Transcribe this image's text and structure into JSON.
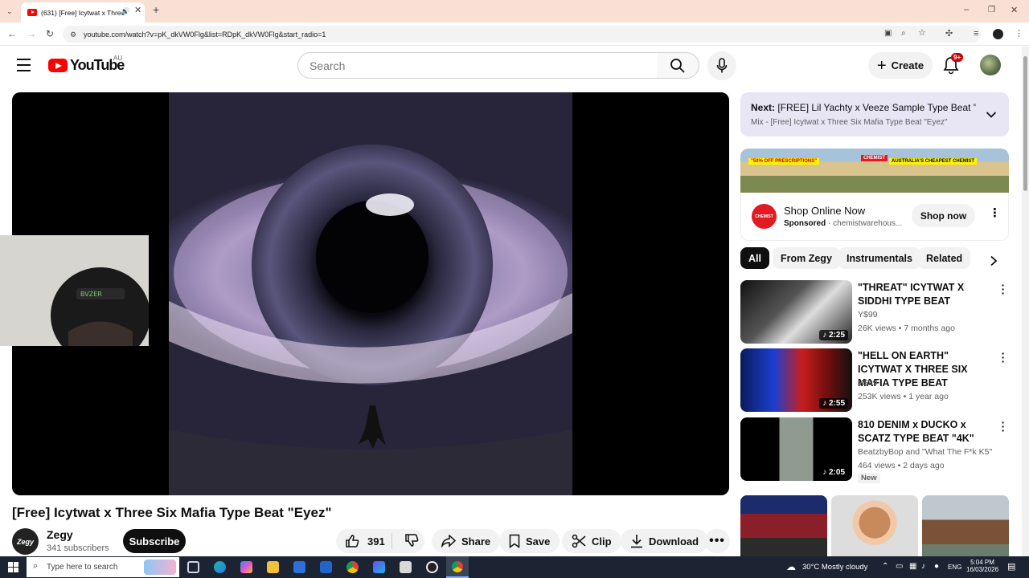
{
  "browser": {
    "tab_title": "(631) [Free] Icytwat x Three",
    "url": "youtube.com/watch?v=pK_dkVW0Flg&list=RDpK_dkVW0Flg&start_radio=1"
  },
  "header": {
    "logo": "YouTube",
    "region": "AU",
    "search_placeholder": "Search",
    "create_label": "Create",
    "notif_badge": "9+"
  },
  "video": {
    "title": "[Free] Icytwat x Three Six Mafia Type Beat \"Eyez\"",
    "channel": "Zegy",
    "channel_avatar": "Zegy",
    "subscribers": "341 subscribers",
    "subscribe_label": "Subscribe",
    "likes": "391",
    "share_label": "Share",
    "save_label": "Save",
    "clip_label": "Clip",
    "download_label": "Download"
  },
  "next": {
    "label": "Next:",
    "title": "[FREE] Lil Yachty x Veeze Sample Type Beat \"...",
    "sub": "Mix - [Free] Icytwat x Three Six Mafia Type Beat \"Eyez\""
  },
  "ad": {
    "banner1": "\"50% OFF PRESCRIPTIONS\"",
    "banner2": "AUSTRALIA'S CHEAPEST CHEMIST",
    "banner_brand": "CHEMIST",
    "brand_short": "CHEMIST",
    "headline": "Shop Online Now",
    "sponsored": "Sponsored",
    "domain": "chemistwarehous...",
    "cta": "Shop now"
  },
  "chips": [
    "All",
    "From Zegy",
    "Instrumentals",
    "Related"
  ],
  "recommendations": [
    {
      "title": "\"THREAT\" ICYTWAT X SIDDHI TYPE BEAT",
      "channel": "Y$99",
      "meta": "26K views • 7 months ago",
      "duration": "2:25",
      "badge": ""
    },
    {
      "title": "\"HELL ON EARTH\" ICYTWAT X THREE SIX MAFIA TYPE BEAT",
      "channel": "Y$99",
      "meta": "253K views • 1 year ago",
      "duration": "2:55",
      "badge": ""
    },
    {
      "title": "810 DENIM x DUCKO x SCATZ TYPE BEAT \"4K\"",
      "channel": "BeatzbyBop and \"What The F*k K5\"",
      "meta": "464 views • 2 days ago",
      "duration": "2:05",
      "badge": "New"
    }
  ],
  "taskbar": {
    "search_placeholder": "Type here to search",
    "weather": "30°C  Mostly cloudy",
    "lang": "ENG",
    "time": "5:04 PM",
    "date": "16/03/2026"
  },
  "colors": {
    "yt_red": "#ff0000",
    "next_bg": "#e8e6f4",
    "chip_active": "#0f0f0f",
    "taskbar": "#1c2433"
  }
}
